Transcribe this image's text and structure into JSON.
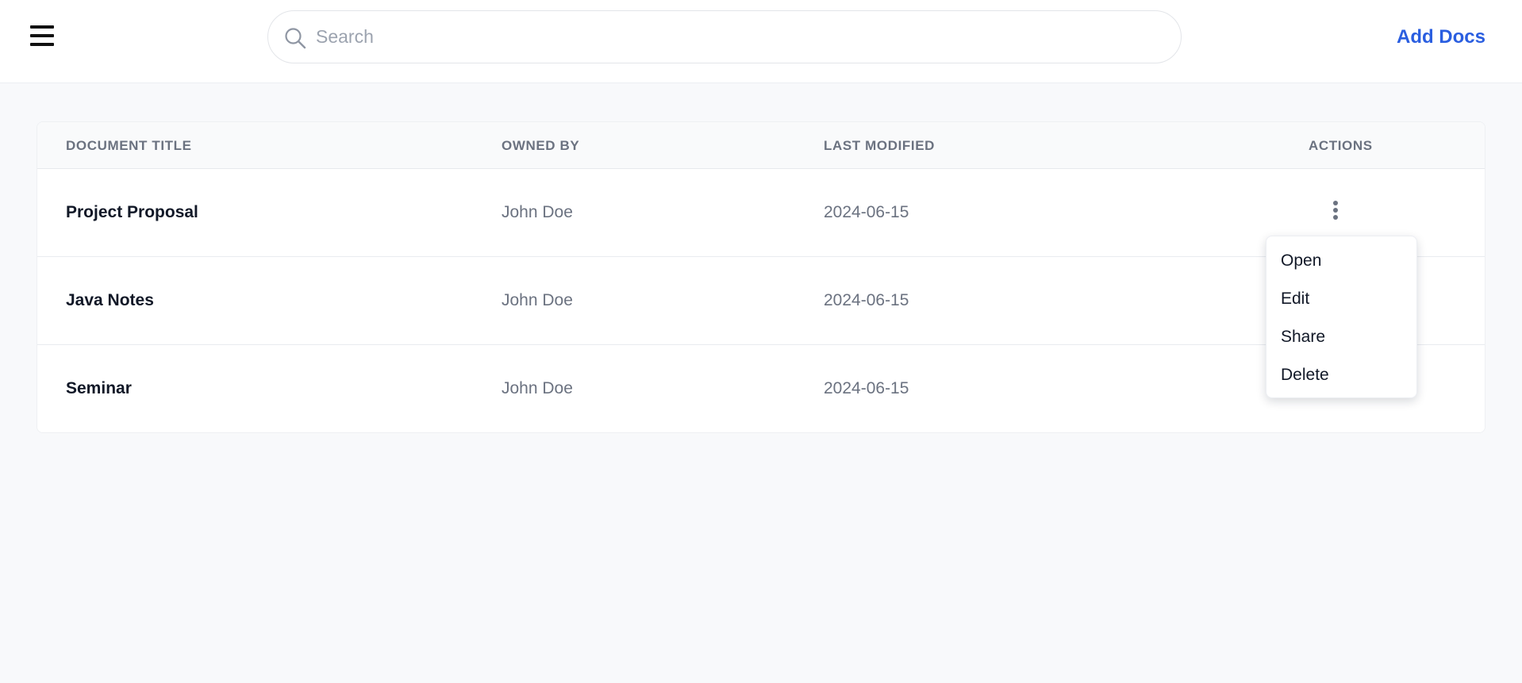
{
  "header": {
    "search": {
      "placeholder": "Search",
      "value": ""
    },
    "add_docs_label": "Add Docs",
    "accent_color": "#2a5ee0"
  },
  "table": {
    "columns": [
      "DOCUMENT TITLE",
      "OWNED BY",
      "LAST MODIFIED",
      "ACTIONS"
    ],
    "rows": [
      {
        "title": "Project Proposal",
        "owner": "John Doe",
        "modified": "2024-06-15"
      },
      {
        "title": "Java Notes",
        "owner": "John Doe",
        "modified": "2024-06-15"
      },
      {
        "title": "Seminar",
        "owner": "John Doe",
        "modified": "2024-06-15"
      }
    ]
  },
  "actions_menu": {
    "open_for_row": "Project Proposal",
    "items": [
      "Open",
      "Edit",
      "Share",
      "Delete"
    ]
  },
  "icons": {
    "menu": "hamburger-menu-icon",
    "search": "search-icon",
    "row_actions": "more-vertical-icon"
  }
}
